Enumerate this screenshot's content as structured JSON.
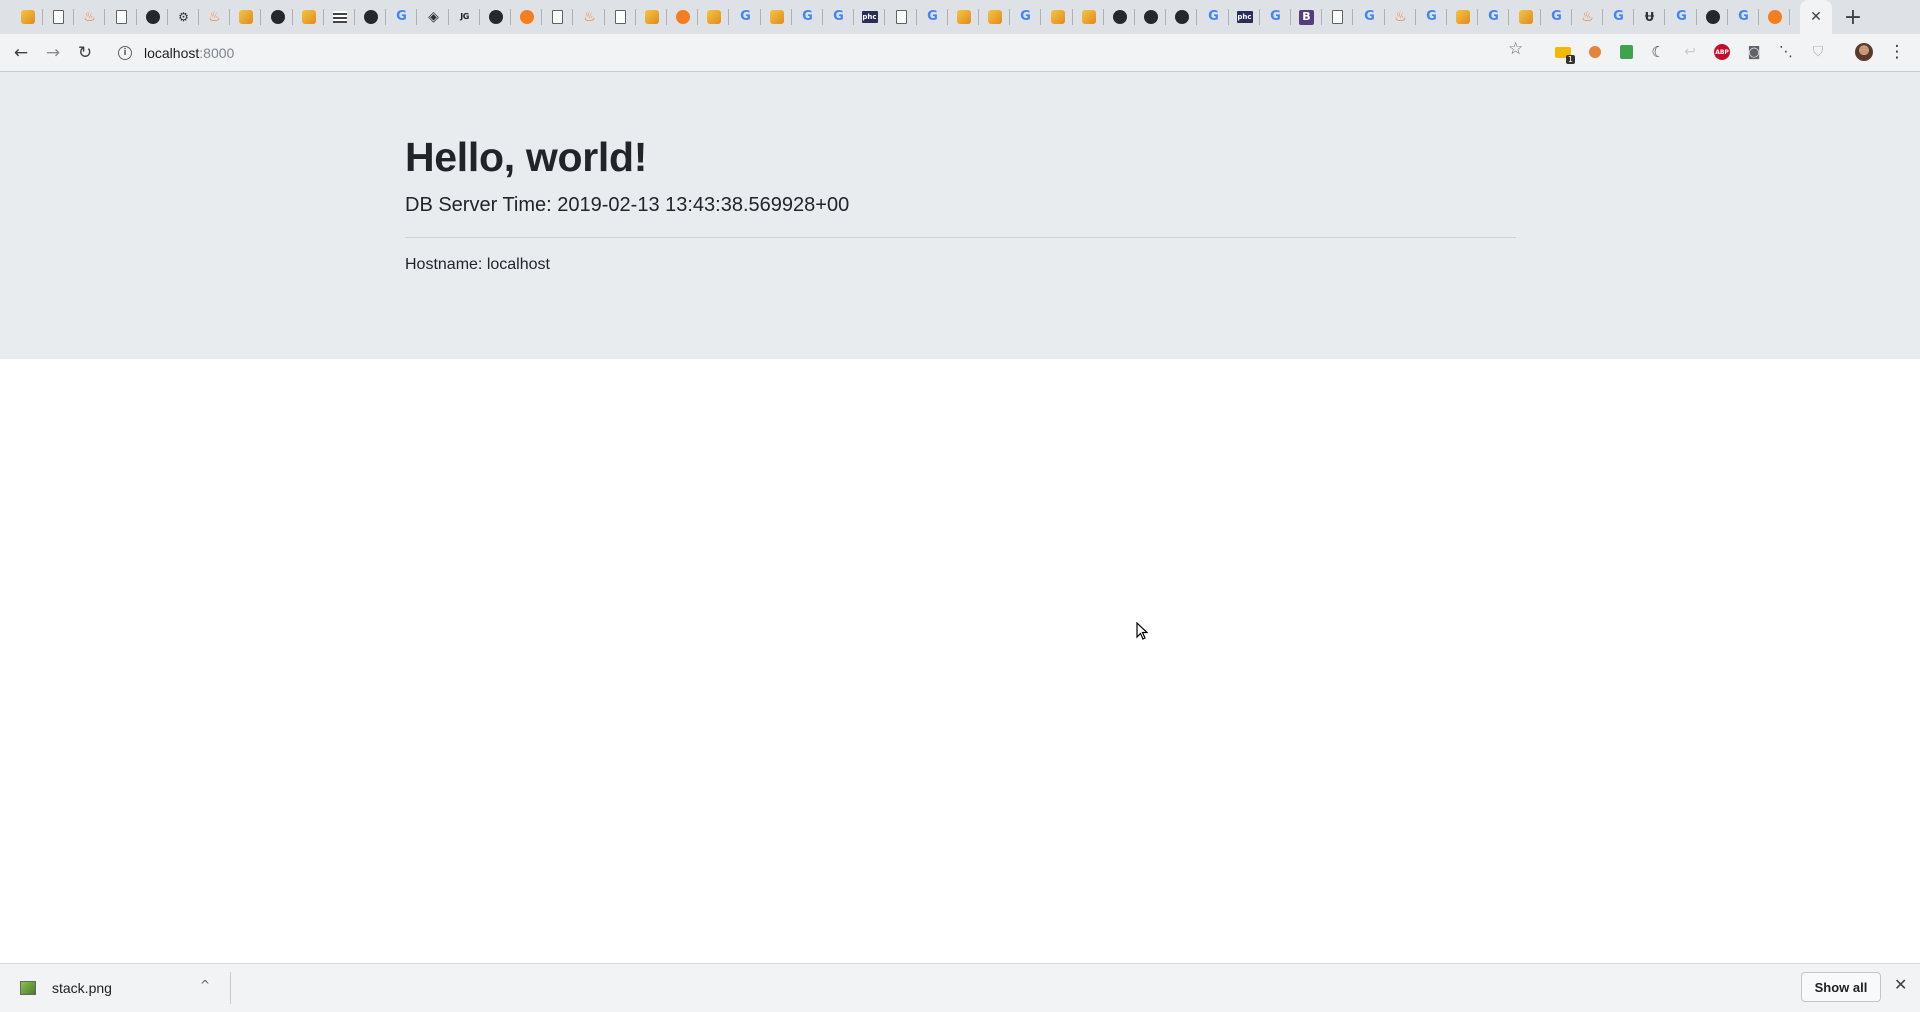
{
  "browser": {
    "tab_favicons": [
      "box",
      "page",
      "stack",
      "page",
      "github",
      "puzzle",
      "stack",
      "box",
      "github",
      "box",
      "grid",
      "github",
      "google",
      "diamond",
      "jg",
      "github",
      "orange",
      "page",
      "stack",
      "page",
      "box",
      "orange",
      "box",
      "google",
      "box",
      "google",
      "google",
      "dark",
      "page",
      "google",
      "box",
      "box",
      "google",
      "box",
      "box",
      "github",
      "github",
      "github",
      "google",
      "dark",
      "google",
      "boot",
      "page",
      "google",
      "stack",
      "google",
      "box",
      "google",
      "box",
      "google",
      "stack",
      "google",
      "ul",
      "google",
      "github",
      "google",
      "orange"
    ],
    "tab_glyphs": {
      "google": "G",
      "jg": "JG",
      "dark": "phc",
      "boot": "B",
      "diamond": "◈",
      "puzzle": "⚙",
      "ul": "Ʉ",
      "stack": "♨",
      "github": "●"
    },
    "new_tab_label": "+",
    "active_tab_close": "✕",
    "nav": {
      "back": "←",
      "forward": "→",
      "reload": "↻"
    },
    "url": {
      "host": "localhost",
      "port": ":8000"
    },
    "bookmark_icon": "☆",
    "extensions": [
      "stats-icon",
      "cookie-icon",
      "evernote-icon",
      "dark-mode-icon",
      "arrow-icon",
      "adblock-icon",
      "camera-icon",
      "rss-icon",
      "shield-icon",
      "avatar",
      "menu-icon"
    ],
    "extension_badge": "1",
    "abp_label": "ABP",
    "menu_glyph": "⋮"
  },
  "page": {
    "title": "Hello, world!",
    "db_time": "DB Server Time: 2019-02-13 13:43:38.569928+00",
    "hostname": "Hostname: localhost"
  },
  "downloads": {
    "file_name": "stack.png",
    "caret": "^",
    "show_all_label": "Show all",
    "close": "✕"
  }
}
